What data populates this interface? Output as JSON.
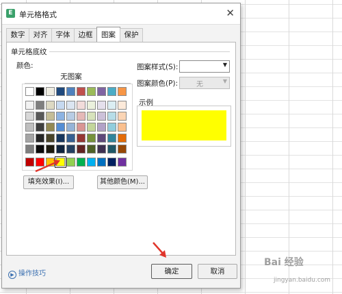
{
  "window": {
    "title": "单元格格式",
    "app_icon_glyph": "E"
  },
  "tabs": [
    {
      "label": "数字",
      "active": false
    },
    {
      "label": "对齐",
      "active": false
    },
    {
      "label": "字体",
      "active": false
    },
    {
      "label": "边框",
      "active": false
    },
    {
      "label": "图案",
      "active": true
    },
    {
      "label": "保护",
      "active": false
    }
  ],
  "shading": {
    "group_label": "单元格底纹",
    "color_label": "颜色:",
    "no_pattern_label": "无图案",
    "selected_color": "#FFFF00",
    "palette_top": [
      "#FFFFFF",
      "#000000",
      "#EEECE1",
      "#1F497D",
      "#4F81BD",
      "#C0504D",
      "#9BBB59",
      "#8064A2",
      "#4BACC6",
      "#F79646",
      "#F9CB3C",
      "#77A860"
    ],
    "palette_grid": [
      [
        "#F2F2F2",
        "#7F7F7F",
        "#DDD9C3",
        "#C6D9F0",
        "#DBE5F1",
        "#F2DCDB",
        "#EBF1DD",
        "#E5E0EC",
        "#DBEEF3",
        "#FDEADA",
        "#FEF4D0",
        "#E6F0DC"
      ],
      [
        "#D8D8D8",
        "#595959",
        "#C4BD97",
        "#8DB3E2",
        "#B8CCE4",
        "#E5B9B7",
        "#D7E3BC",
        "#CCC1D9",
        "#B7DDE8",
        "#FBD5B5",
        "#FDE9A2",
        "#CDE1BA"
      ],
      [
        "#BFBFBF",
        "#3F3F3F",
        "#938953",
        "#548DD4",
        "#95B3D7",
        "#D99694",
        "#C3D69B",
        "#B2A2C7",
        "#92CDDC",
        "#FAC08F",
        "#FCDD73",
        "#B4D298"
      ],
      [
        "#A5A5A5",
        "#262626",
        "#494429",
        "#17365D",
        "#366092",
        "#953734",
        "#76923C",
        "#5F497A",
        "#31859B",
        "#E36C09",
        "#C99A1A",
        "#5A8742"
      ],
      [
        "#7F7F7F",
        "#0C0C0C",
        "#1D1B10",
        "#0F243E",
        "#244061",
        "#632423",
        "#4F6128",
        "#3F3151",
        "#205867",
        "#974806",
        "#86660F",
        "#3C5A2C"
      ]
    ],
    "palette_standard": [
      "#C00000",
      "#FF0000",
      "#FFC000",
      "#FFFF00",
      "#92D050",
      "#00B050",
      "#00B0F0",
      "#0070C0",
      "#002060",
      "#7030A0"
    ],
    "fill_effects_button": "填充效果(I)...",
    "more_colors_button": "其他颜色(M)..."
  },
  "pattern": {
    "style_label": "图案样式(S):",
    "style_value": "",
    "color_label": "图案颜色(P):",
    "color_value": "无",
    "sample_label": "示例"
  },
  "footer": {
    "tips_label": "操作技巧",
    "ok_button": "确定",
    "cancel_button": "取消"
  },
  "watermark": {
    "line1": "Bai 经验",
    "line2": "jingyan.baidu.com"
  },
  "annotation_color": "#E0352B"
}
